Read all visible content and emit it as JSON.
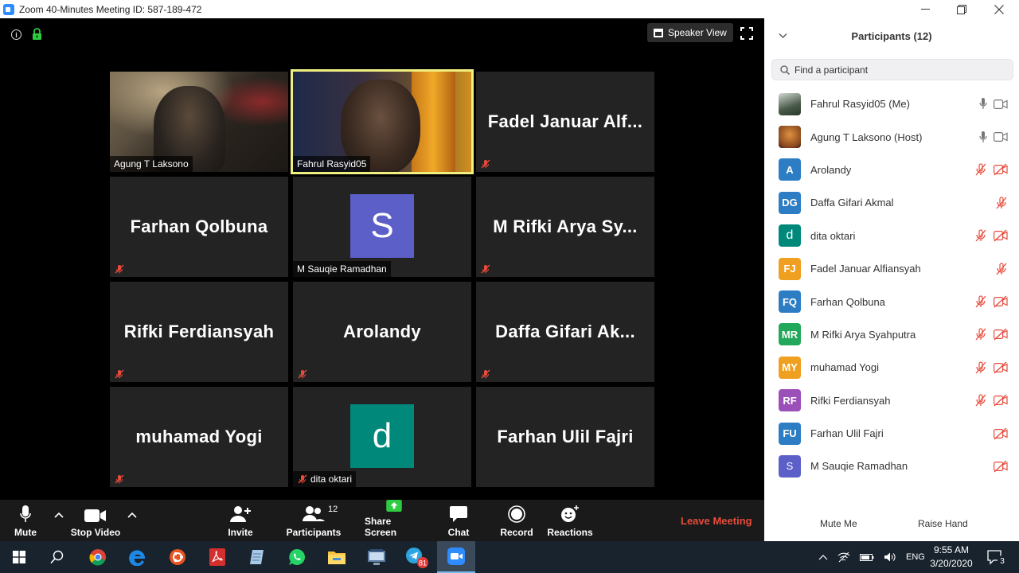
{
  "window": {
    "title": "Zoom 40-Minutes Meeting ID: 587-189-472",
    "minimize": "—",
    "restore": "❐",
    "close": "✕"
  },
  "meeting": {
    "view_button": "Speaker View",
    "tiles": [
      {
        "kind": "video",
        "label": "Agung T Laksono",
        "muted": false
      },
      {
        "kind": "video",
        "label": "Fahrul Rasyid05",
        "muted": false,
        "active": true
      },
      {
        "kind": "name",
        "bigname": "Fadel Januar Alf...",
        "muted": true
      },
      {
        "kind": "name",
        "bigname": "Farhan Qolbuna",
        "muted": true
      },
      {
        "kind": "avatar",
        "initial": "S",
        "label": "M Sauqie Ramadhan",
        "color": "#5b5fc7",
        "muted": false
      },
      {
        "kind": "name",
        "bigname": "M Rifki Arya Sy...",
        "muted": true
      },
      {
        "kind": "name",
        "bigname": "Rifki Ferdiansyah",
        "muted": true
      },
      {
        "kind": "name",
        "bigname": "Arolandy",
        "muted": true
      },
      {
        "kind": "name",
        "bigname": "Daffa Gifari Ak...",
        "muted": true
      },
      {
        "kind": "name",
        "bigname": "muhamad Yogi",
        "muted": true
      },
      {
        "kind": "avatar",
        "initial": "d",
        "label": "dita oktari",
        "color": "#00897b",
        "muted": true
      },
      {
        "kind": "name",
        "bigname": "Farhan Ulil Fajri",
        "muted": false
      }
    ]
  },
  "toolbar": {
    "mute": "Mute",
    "stop_video": "Stop Video",
    "invite": "Invite",
    "participants": "Participants",
    "participants_count": "12",
    "share_screen": "Share Screen",
    "chat": "Chat",
    "record": "Record",
    "reactions": "Reactions",
    "leave": "Leave Meeting"
  },
  "panel": {
    "title": "Participants (12)",
    "search_placeholder": "Find a participant",
    "participants": [
      {
        "name": "Fahrul Rasyid05 (Me)",
        "initials": "",
        "color": "photo",
        "mic": "on",
        "video": "on"
      },
      {
        "name": "Agung T Laksono (Host)",
        "initials": "",
        "color": "photo2",
        "mic": "on",
        "video": "on"
      },
      {
        "name": "Arolandy",
        "initials": "A",
        "color": "#2d7dc4",
        "mic": "off",
        "video": "off"
      },
      {
        "name": "Daffa Gifari Akmal",
        "initials": "DG",
        "color": "#2d7dc4",
        "mic": "off",
        "video": "none"
      },
      {
        "name": "dita oktari",
        "initials": "d",
        "color": "#00897b",
        "mic": "off",
        "video": "off"
      },
      {
        "name": "Fadel Januar Alfiansyah",
        "initials": "FJ",
        "color": "#f0a020",
        "mic": "off",
        "video": "none"
      },
      {
        "name": "Farhan Qolbuna",
        "initials": "FQ",
        "color": "#2d7dc4",
        "mic": "off",
        "video": "off"
      },
      {
        "name": "M Rifki Arya Syahputra",
        "initials": "MR",
        "color": "#22a85a",
        "mic": "off",
        "video": "off"
      },
      {
        "name": "muhamad Yogi",
        "initials": "MY",
        "color": "#f0a020",
        "mic": "off",
        "video": "off"
      },
      {
        "name": "Rifki Ferdiansyah",
        "initials": "RF",
        "color": "#9b4fb8",
        "mic": "off",
        "video": "off"
      },
      {
        "name": "Farhan Ulil Fajri",
        "initials": "FU",
        "color": "#2d7dc4",
        "mic": "none",
        "video": "off"
      },
      {
        "name": "M Sauqie Ramadhan",
        "initials": "S",
        "color": "#5b5fc7",
        "mic": "none",
        "video": "off"
      }
    ],
    "mute_me": "Mute Me",
    "raise_hand": "Raise Hand"
  },
  "taskbar": {
    "telegram_badge": "81",
    "lang": "ENG",
    "time": "9:55 AM",
    "date": "3/20/2020",
    "notifications": "3"
  }
}
